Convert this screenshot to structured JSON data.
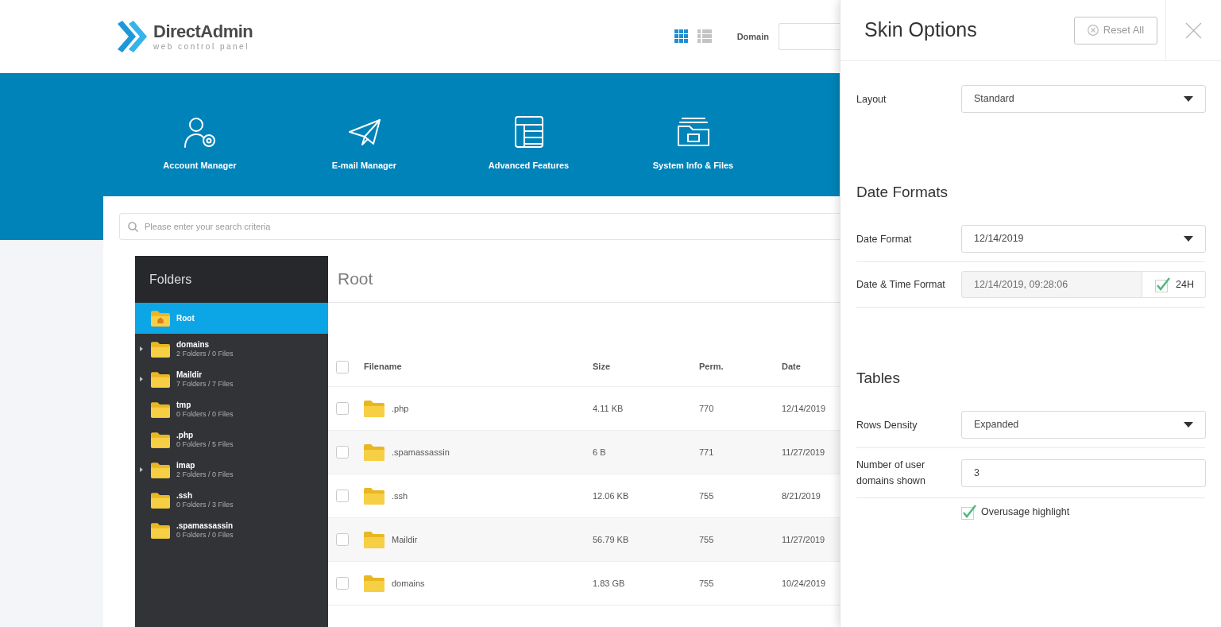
{
  "background": {
    "logo": {
      "name": "DirectAdmin",
      "tagline": "web control panel"
    },
    "view_toggle": [
      {
        "kind": "grid",
        "selected": true
      },
      {
        "kind": "list",
        "selected": false
      }
    ],
    "domain": {
      "label": "Domain"
    },
    "nav": [
      {
        "kind": "accounts",
        "label": "Account Manager"
      },
      {
        "kind": "email",
        "label": "E-mail Manager"
      },
      {
        "kind": "advanced",
        "label": "Advanced Features"
      },
      {
        "kind": "system",
        "label": "System Info & Files"
      }
    ],
    "search": {
      "placeholder": "Please enter your search criteria"
    },
    "folders": {
      "title": "Folders",
      "items": [
        {
          "kind": "root",
          "name": "Root",
          "selected": true,
          "expandable": false
        },
        {
          "kind": "folder",
          "name": "domains",
          "info": "2 Folders / 0 Files",
          "selected": false,
          "expandable": true
        },
        {
          "kind": "folder",
          "name": "Maildir",
          "info": "7 Folders / 7 Files",
          "selected": false,
          "expandable": true
        },
        {
          "kind": "folder",
          "name": "tmp",
          "info": "0 Folders / 0 Files",
          "selected": false,
          "expandable": false
        },
        {
          "kind": "folder",
          "name": ".php",
          "info": "0 Folders / 5 Files",
          "selected": false,
          "expandable": false
        },
        {
          "kind": "folder",
          "name": "imap",
          "info": "2 Folders / 0 Files",
          "selected": false,
          "expandable": true
        },
        {
          "kind": "folder",
          "name": ".ssh",
          "info": "0 Folders / 3 Files",
          "selected": false,
          "expandable": false
        },
        {
          "kind": "folder",
          "name": ".spamassassin",
          "info": "0 Folders / 0 Files",
          "selected": false,
          "expandable": false
        }
      ]
    },
    "file_list": {
      "title": "Root",
      "header_checked": false,
      "columns": [
        "Filename",
        "Size",
        "Perm.",
        "Date"
      ],
      "rows": [
        {
          "name": ".php",
          "size": "4.11 KB",
          "perm": "770",
          "date": "12/14/2019",
          "checked": false
        },
        {
          "name": ".spamassassin",
          "size": "6 B",
          "perm": "771",
          "date": "11/27/2019",
          "checked": false
        },
        {
          "name": ".ssh",
          "size": "12.06 KB",
          "perm": "755",
          "date": "8/21/2019",
          "checked": false
        },
        {
          "name": "Maildir",
          "size": "56.79 KB",
          "perm": "755",
          "date": "11/27/2019",
          "checked": false
        },
        {
          "name": "domains",
          "size": "1.83 GB",
          "perm": "755",
          "date": "10/24/2019",
          "checked": false
        }
      ]
    }
  },
  "panel": {
    "title": "Skin Options",
    "reset_button": "Reset All",
    "sections": [
      {
        "fields": [
          {
            "kind": "select",
            "label": "Layout",
            "value": "Standard"
          }
        ]
      },
      {
        "heading": "Date Formats",
        "fields": [
          {
            "kind": "select",
            "label": "Date Format",
            "value": "12/14/2019"
          },
          {
            "kind": "datetime",
            "label": "Date & Time Format",
            "value": "12/14/2019, 09:28:06",
            "disabled": true,
            "toggle": {
              "label": "24H",
              "checked": true
            }
          }
        ]
      },
      {
        "heading": "Tables",
        "fields": [
          {
            "kind": "select",
            "label": "Rows Density",
            "value": "Expanded"
          },
          {
            "kind": "input",
            "label": "Number of user domains shown",
            "value": "3"
          },
          {
            "kind": "checkbox",
            "label": "Overusage highlight",
            "checked": true
          }
        ]
      }
    ]
  }
}
